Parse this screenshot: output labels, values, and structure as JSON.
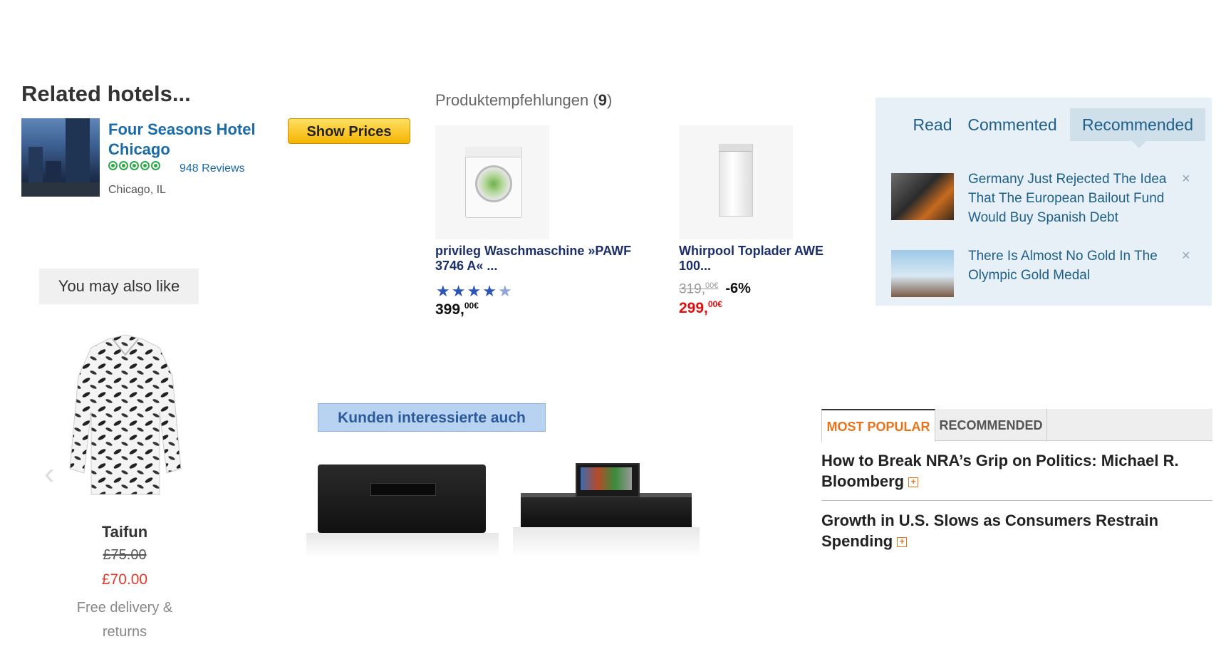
{
  "related_hotels": {
    "title": "Related hotels...",
    "hotel_name": "Four Seasons Hotel Chicago",
    "rating": 5,
    "reviews": "948 Reviews",
    "location": "Chicago, IL",
    "button_label": "Show Prices"
  },
  "you_may_also_like": {
    "heading": "You may also like",
    "product_name": "Taifun",
    "old_price": "£75.00",
    "new_price": "£70.00",
    "shipping": "Free delivery & returns"
  },
  "produktempfehlungen": {
    "title": "Produktempfehlungen",
    "count": "9",
    "items": [
      {
        "name": "privileg Waschmaschine »PAWF 3746 A« ...",
        "rating": 4.5,
        "price": "399,",
        "price_cents": "00€"
      },
      {
        "name": "Whirpool Toplader AWE 100...",
        "old_price": "319,",
        "old_price_cents": "00€",
        "discount": "-6%",
        "price": "299,",
        "price_cents": "00€"
      }
    ]
  },
  "read_tabs": {
    "tabs": [
      "Read",
      "Commented",
      "Recommended"
    ],
    "active": "Recommended",
    "articles": [
      {
        "title": "Germany Just Rejected The Idea That The European Bailout Fund Would Buy Spanish Debt"
      },
      {
        "title": "There Is Almost No Gold In The Olympic Gold Medal"
      }
    ],
    "close_glyph": "×"
  },
  "kunden": {
    "heading": "Kunden interessierte auch"
  },
  "most_popular": {
    "tabs": [
      "MOST POPULAR",
      "RECOMMENDED"
    ],
    "active": "MOST POPULAR",
    "items": [
      {
        "title": "How to Break NRA’s Grip on Politics: Michael R. Bloomberg"
      },
      {
        "title": "Growth in U.S. Slows as Consumers Restrain Spending"
      }
    ],
    "expand_glyph": "+"
  },
  "colors": {
    "link_blue": "#1a6aa8",
    "rating_green": "#2fa84a",
    "sale_red": "#e01010",
    "accent_orange": "#e8731a"
  }
}
